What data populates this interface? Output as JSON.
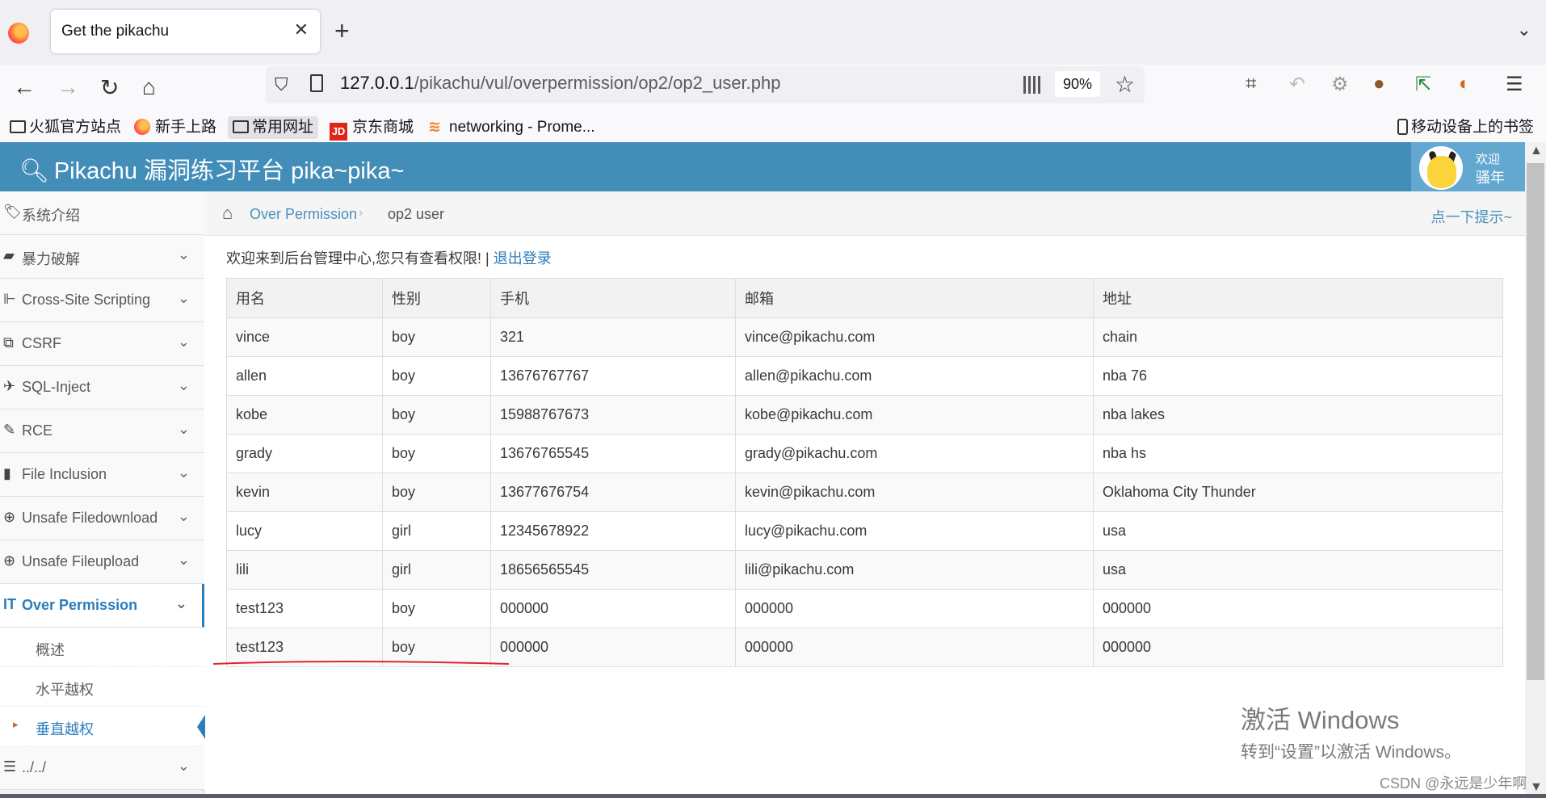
{
  "browser": {
    "tab_title": "Get the pikachu",
    "url_host": "127.0.0.1",
    "url_path": "/pikachu/vul/overpermission/op2/op2_user.php",
    "zoom": "90%",
    "bookmarks": [
      "火狐官方站点",
      "新手上路",
      "常用网址",
      "京东商城",
      "networking - Prome...",
      "移动设备上的书签"
    ],
    "jd_badge": "JD"
  },
  "app": {
    "title": "Pikachu 漏洞练习平台 pika~pika~",
    "user": {
      "welcome": "欢迎",
      "name": "骚年"
    }
  },
  "sidebar": {
    "items": [
      {
        "label": "系统介绍",
        "icon": "tag-icon"
      },
      {
        "label": "暴力破解",
        "icon": "lock-icon"
      },
      {
        "label": "Cross-Site Scripting",
        "icon": "sitemap-icon"
      },
      {
        "label": "CSRF",
        "icon": "share-icon"
      },
      {
        "label": "SQL-Inject",
        "icon": "plane-icon"
      },
      {
        "label": "RCE",
        "icon": "pencil-icon"
      },
      {
        "label": "File Inclusion",
        "icon": "file-icon"
      },
      {
        "label": "Unsafe Filedownload",
        "icon": "download-icon"
      },
      {
        "label": "Unsafe Fileupload",
        "icon": "upload-icon"
      },
      {
        "label": "Over Permission",
        "icon": "text-width-icon"
      },
      {
        "label": "../../",
        "icon": "list-icon"
      }
    ],
    "subitems": [
      "概述",
      "水平越权",
      "垂直越权"
    ]
  },
  "breadcrumb": {
    "link": "Over Permission",
    "current": "op2 user",
    "hint": "点一下提示~"
  },
  "main": {
    "welcome_text": "欢迎来到后台管理中心,您只有查看权限! |",
    "logout": "退出登录",
    "table": {
      "headers": [
        "用名",
        "性别",
        "手机",
        "邮箱",
        "地址"
      ],
      "rows": [
        [
          "vince",
          "boy",
          "321",
          "vince@pikachu.com",
          "chain"
        ],
        [
          "allen",
          "boy",
          "13676767767",
          "allen@pikachu.com",
          "nba 76"
        ],
        [
          "kobe",
          "boy",
          "15988767673",
          "kobe@pikachu.com",
          "nba lakes"
        ],
        [
          "grady",
          "boy",
          "13676765545",
          "grady@pikachu.com",
          "nba hs"
        ],
        [
          "kevin",
          "boy",
          "13677676754",
          "kevin@pikachu.com",
          "Oklahoma City Thunder"
        ],
        [
          "lucy",
          "girl",
          "12345678922",
          "lucy@pikachu.com",
          "usa"
        ],
        [
          "lili",
          "girl",
          "18656565545",
          "lili@pikachu.com",
          "usa"
        ],
        [
          "test123",
          "boy",
          "000000",
          "000000",
          "000000"
        ],
        [
          "test123",
          "boy",
          "000000",
          "000000",
          "000000"
        ]
      ]
    }
  },
  "overlay": {
    "activate_title": "激活 Windows",
    "activate_sub": "转到“设置”以激活 Windows。",
    "watermark": "CSDN @永远是少年啊"
  },
  "colors": {
    "header_blue": "#438eb9",
    "link_blue": "#2b7dbc",
    "annotation_red": "#e0242b"
  }
}
